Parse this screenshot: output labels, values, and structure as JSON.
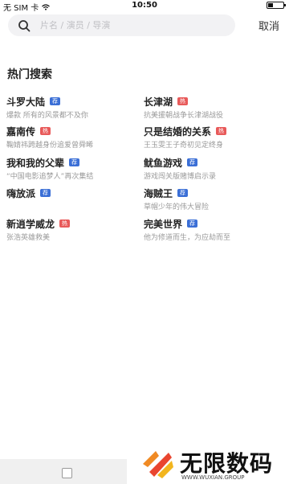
{
  "status": {
    "carrier": "无 SIM 卡",
    "time": "10:50",
    "battery_level": 0.35
  },
  "search": {
    "placeholder": "片名 / 演员 / 导演",
    "icon": "search-icon",
    "cancel_label": "取消"
  },
  "hot_section": {
    "title": "热门搜索",
    "items": [
      {
        "name": "斗罗大陆",
        "badge": "荐",
        "badge_type": "rec",
        "desc": "爆款 所有的风景都不及你"
      },
      {
        "name": "长津湖",
        "badge": "热",
        "badge_type": "hot",
        "desc": "抗美援朝战争长津湖战役"
      },
      {
        "name": "嘉南传",
        "badge": "热",
        "badge_type": "hot",
        "desc": "鞠婧祎跨越身份追爱曾舜晞"
      },
      {
        "name": "只是结婚的关系",
        "badge": "热",
        "badge_type": "hot",
        "desc": "王玉雯王子奇初见定终身"
      },
      {
        "name": "我和我的父辈",
        "badge": "荐",
        "badge_type": "rec",
        "desc": "“中国电影追梦人”再次集结"
      },
      {
        "name": "鱿鱼游戏",
        "badge": "荐",
        "badge_type": "rec",
        "desc": "游戏闯关版赌博启示录"
      },
      {
        "name": "嗨放派",
        "badge": "荐",
        "badge_type": "rec",
        "desc": ""
      },
      {
        "name": "海贼王",
        "badge": "荐",
        "badge_type": "rec",
        "desc": "草帽少年的伟大冒险"
      },
      {
        "name": "新逍学威龙",
        "badge": "热",
        "badge_type": "hot",
        "desc": "张浩英雄救美"
      },
      {
        "name": "完美世界",
        "badge": "荐",
        "badge_type": "rec",
        "desc": "他为修道而生，为应劫而至"
      }
    ]
  },
  "watermark": {
    "title": "无限数码",
    "sub": "WWW.WUXIAN.GROUP"
  },
  "colors": {
    "hot_badge": "#e85a5a",
    "rec_badge": "#3b6fd6",
    "search_bg": "#f2f2f4"
  }
}
